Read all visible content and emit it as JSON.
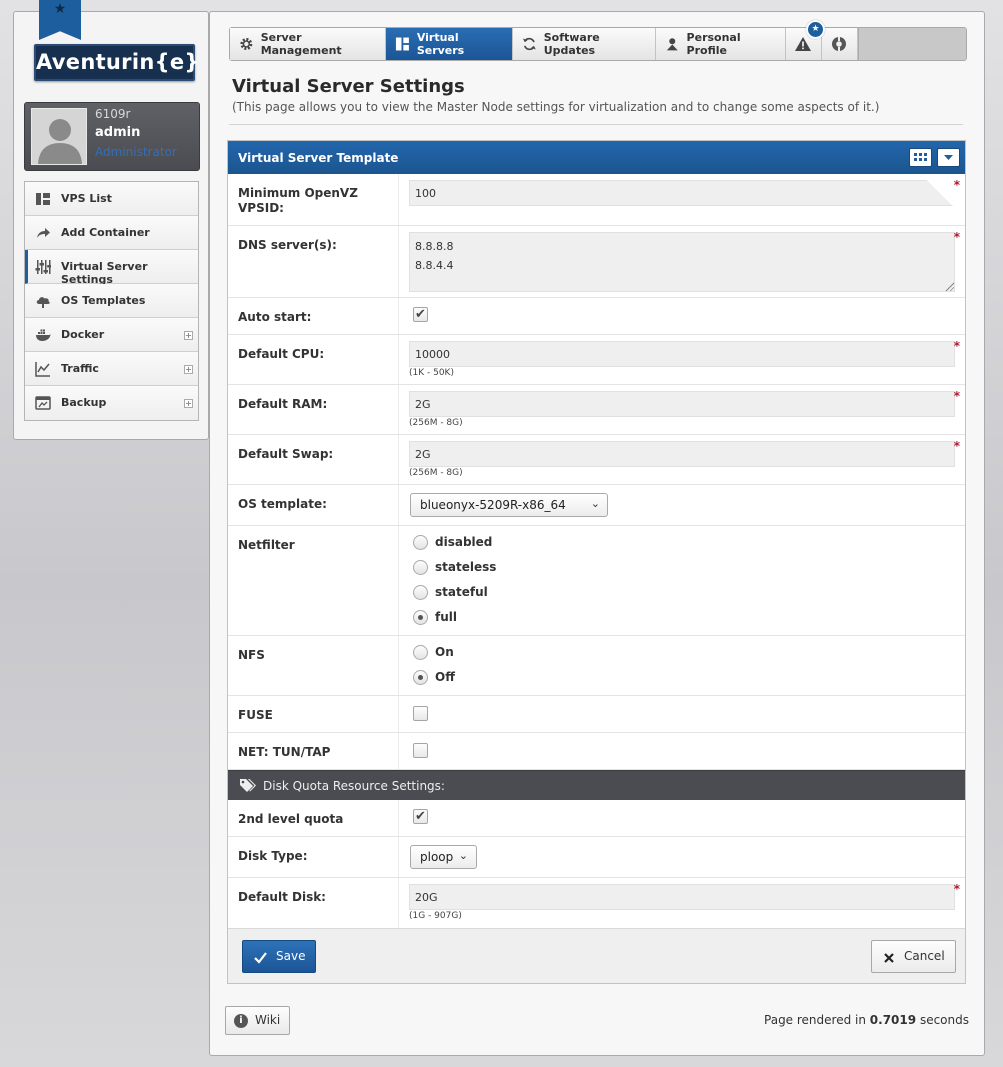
{
  "brand": {
    "logo_text": "Aventurin{e}"
  },
  "user": {
    "id": "6109r",
    "name": "admin",
    "role": "Administrator"
  },
  "sidebar": {
    "items": [
      {
        "label": "VPS List",
        "icon": "vps-list-icon"
      },
      {
        "label": "Add Container",
        "icon": "share-arrow-icon"
      },
      {
        "label": "Virtual Server Settings",
        "icon": "sliders-icon",
        "active": true
      },
      {
        "label": "OS Templates",
        "icon": "cloud-icon"
      },
      {
        "label": "Docker",
        "icon": "docker-whale-icon",
        "expandable": true
      },
      {
        "label": "Traffic",
        "icon": "line-chart-icon",
        "expandable": true
      },
      {
        "label": "Backup",
        "icon": "backup-icon",
        "expandable": true
      }
    ],
    "expand_glyph": "+"
  },
  "tabs": [
    {
      "label": "Server Management",
      "icon": "gear-icon"
    },
    {
      "label": "Virtual Servers",
      "icon": "dashboard-icon",
      "active": true
    },
    {
      "label": "Software Updates",
      "icon": "refresh-icon"
    },
    {
      "label": "Personal Profile",
      "icon": "person-icon"
    }
  ],
  "page": {
    "title": "Virtual Server Settings",
    "subtitle": "(This page allows you to view the Master Node settings for virtualization and to change some aspects of it.)"
  },
  "form": {
    "header": "Virtual Server Template",
    "min_vpsid": {
      "label": "Minimum OpenVZ VPSID:",
      "value": "100"
    },
    "dns": {
      "label": "DNS server(s):",
      "value": "8.8.8.8\n8.8.4.4"
    },
    "auto_start": {
      "label": "Auto start:",
      "checked": true
    },
    "cpu": {
      "label": "Default CPU:",
      "value": "10000",
      "hint": "(1K - 50K)"
    },
    "ram": {
      "label": "Default RAM:",
      "value": "2G",
      "hint": "(256M - 8G)"
    },
    "swap": {
      "label": "Default Swap:",
      "value": "2G",
      "hint": "(256M - 8G)"
    },
    "os_template": {
      "label": "OS template:",
      "value": "blueonyx-5209R-x86_64"
    },
    "netfilter": {
      "label": "Netfilter",
      "options": [
        "disabled",
        "stateless",
        "stateful",
        "full"
      ],
      "selected": "full"
    },
    "nfs": {
      "label": "NFS",
      "options": [
        "On",
        "Off"
      ],
      "selected": "Off"
    },
    "fuse": {
      "label": "FUSE",
      "checked": false
    },
    "tuntap": {
      "label": "NET: TUN/TAP",
      "checked": false
    },
    "disk_section": "Disk Quota Resource Settings:",
    "quota2": {
      "label": "2nd level quota",
      "checked": true
    },
    "disk_type": {
      "label": "Disk Type:",
      "value": "ploop"
    },
    "disk": {
      "label": "Default Disk:",
      "value": "20G",
      "hint": "(1G - 907G)"
    },
    "required_mark": "*",
    "check_glyph": "✔",
    "caret_glyph": "⌄"
  },
  "buttons": {
    "save": "Save",
    "cancel": "Cancel",
    "wiki": "Wiki"
  },
  "footer": {
    "render_prefix": "Page rendered in",
    "render_time": "0.7019",
    "render_suffix": "seconds"
  },
  "colors": {
    "accent": "#1d5e9e",
    "required": "#b0182c",
    "section": "#4a4c52"
  }
}
